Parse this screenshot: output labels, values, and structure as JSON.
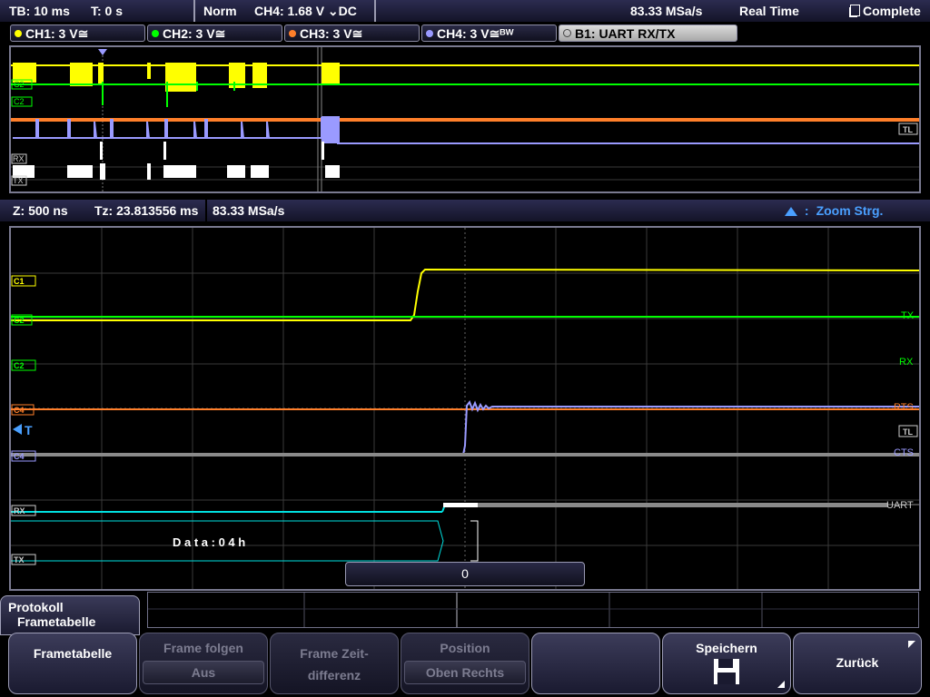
{
  "status": {
    "timebase": "TB: 10 ms",
    "trigger_time": "T: 0 s",
    "trigger_mode": "Norm",
    "trigger_source": "CH4: 1.68 V ⌄DC",
    "sample_rate": "83.33 MSa/s",
    "acq_mode": "Real Time",
    "state": "Complete"
  },
  "channels": [
    {
      "label": "CH1: 3 V≅",
      "color": "#ffff00"
    },
    {
      "label": "CH2: 3 V≅",
      "color": "#00ff00"
    },
    {
      "label": "CH3: 3 V≅",
      "color": "#ff7f2a"
    },
    {
      "label": "CH4: 3 V≅ᴮᵂ",
      "color": "#9a9aff"
    },
    {
      "label": "B1:  UART RX/TX",
      "color": "#ffffff"
    }
  ],
  "overview_markers": {
    "c2": "C2",
    "rx": "RX",
    "tx": "TX",
    "tl": "TL"
  },
  "zoom_bar": {
    "zoom": "Z: 500 ns",
    "tz": "Tz: 23.813556 ms",
    "rate": "83.33 MSa/s",
    "strg": "Zoom Strg."
  },
  "zoom_markers": {
    "c1": "C1",
    "c2": "C2",
    "c4": "C4",
    "rx": "RX",
    "tx": "TX",
    "tl": "TL",
    "right_tx": "TX",
    "right_rx": "RX",
    "right_rts": "RTS",
    "right_cts": "CTS",
    "right_uart": "UART",
    "data_label": "D a t a : 0 4 h",
    "time_value": "0"
  },
  "frame_tab": {
    "line1": "Protokoll",
    "line2": "Frametabelle"
  },
  "softkeys": {
    "frametabelle": "Frametabelle",
    "frame_folgen": "Frame folgen",
    "frame_folgen_sub": "Aus",
    "frame_zeit_1": "Frame Zeit-",
    "frame_zeit_2": "differenz",
    "position": "Position",
    "position_sub": "Oben Rechts",
    "speichern": "Speichern",
    "zurueck": "Zurück"
  },
  "colors": {
    "ch1": "#ffff00",
    "ch2": "#00ff00",
    "ch3": "#ff7f2a",
    "ch4": "#9a9aff",
    "cyan": "#00e0e0",
    "accent": "#4aa0ff"
  }
}
